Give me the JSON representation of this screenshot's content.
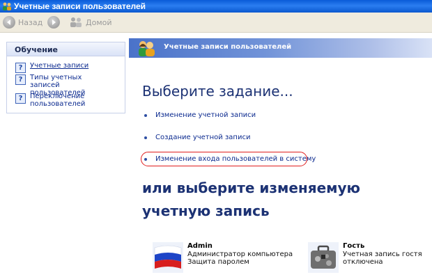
{
  "window": {
    "title": "Учетные записи пользователей"
  },
  "toolbar": {
    "back_label": "Назад",
    "home_label": "Домой"
  },
  "learn": {
    "heading": "Обучение",
    "items": [
      {
        "label": "Учетные записи"
      },
      {
        "label": "Типы учетных записей пользователей"
      },
      {
        "label": "Переключение пользователей"
      }
    ]
  },
  "main": {
    "header_title": "Учетные записи пользователей",
    "task_heading": "Выберите задание...",
    "tasks": [
      {
        "label": "Изменение учетной записи"
      },
      {
        "label": "Создание учетной записи"
      },
      {
        "label": "Изменение входа пользователей в систему"
      }
    ],
    "or_heading": "или выберите изменяемую учетную запись",
    "accounts": [
      {
        "name": "Admin",
        "line1": "Администратор компьютера",
        "line2": "Защита паролем",
        "picture": "russian-flag"
      },
      {
        "name": "Гость",
        "line1": "Учетная запись гостя",
        "line2": "отключена",
        "picture": "briefcase"
      }
    ]
  },
  "colors": {
    "titlebar": "#0a5bd8",
    "link": "#0b2a8f",
    "heading": "#1c3274",
    "highlight": "#e01d1d"
  }
}
